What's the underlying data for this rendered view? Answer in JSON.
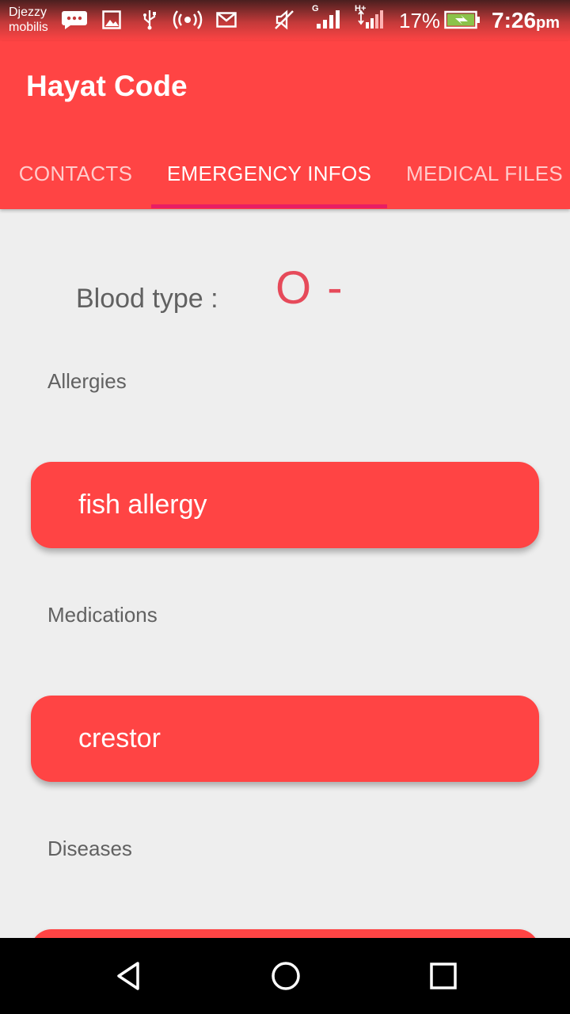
{
  "status_bar": {
    "carrier_line1": "Djezzy",
    "carrier_line2": "mobilis",
    "network_type_1": "G",
    "network_type_2": "H+",
    "battery_percent": "17%",
    "time": "7:26",
    "time_suffix": "pm",
    "icons": [
      "messages-icon",
      "image-icon",
      "usb-icon",
      "hotspot-icon",
      "mail-icon",
      "mute-icon",
      "signal-icon",
      "signal-icon",
      "battery-charging-icon"
    ],
    "battery_color": "#8bc34a"
  },
  "app": {
    "title": "Hayat Code",
    "primary_color": "#ff4444",
    "accent_color": "#e91e63"
  },
  "tabs": [
    {
      "label": "CONTACTS",
      "active": false
    },
    {
      "label": "EMERGENCY INFOS",
      "active": true
    },
    {
      "label": "MEDICAL FILES",
      "active": false
    }
  ],
  "emergency": {
    "blood_type_label": "Blood type :",
    "blood_type_value": "O -",
    "sections": [
      {
        "label": "Allergies",
        "items": [
          "fish allergy"
        ]
      },
      {
        "label": "Medications",
        "items": [
          "crestor"
        ]
      },
      {
        "label": "Diseases",
        "items": [
          ""
        ]
      }
    ]
  },
  "nav": {
    "icons": [
      "back-icon",
      "home-icon",
      "recents-icon"
    ]
  }
}
